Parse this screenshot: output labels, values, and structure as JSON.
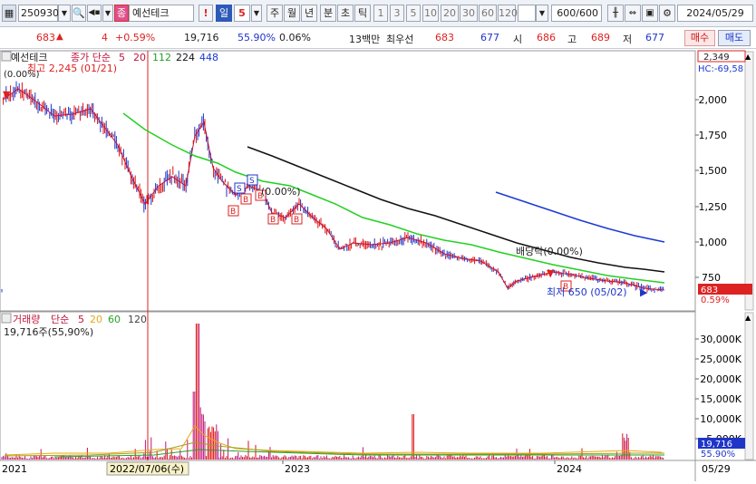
{
  "toolbar": {
    "code": "250930",
    "jong": "종",
    "name": "예선테크",
    "alert": "!",
    "period_label": "일",
    "period_value": "5",
    "ju": "주",
    "wol": "월",
    "nyeon": "년",
    "bun": "분",
    "cho": "초",
    "tik": "틱",
    "intervals": [
      "1",
      "3",
      "5",
      "10",
      "20",
      "30",
      "60",
      "120"
    ],
    "count": "600/600",
    "date": "2024/05/29"
  },
  "info": {
    "price": "683",
    "change": "4",
    "change_pct": "+0.59%",
    "volume": "19,716",
    "vol_ratio": "55.90%",
    "turnover": "0.06%",
    "unit": "13백만",
    "priority": "최우선",
    "ask": "683",
    "bid": "677",
    "open_label": "시",
    "open": "686",
    "high_label": "고",
    "high": "689",
    "low_label": "저",
    "low": "677",
    "buy": "매수",
    "sell": "매도"
  },
  "price_panel": {
    "title": "예선테크",
    "ma_label": "종가 단순",
    "ma_periods": [
      "5",
      "20",
      "112",
      "224",
      "448"
    ],
    "high_note": "최고 2,245 (01/21)",
    "low_note": "최저 650 (05/02)",
    "pct_note1": "(0.00%)",
    "pct_note2": "배당락(0.00%)",
    "pct_note3": "(0.00%)",
    "hc_label": "HC:-69,58",
    "top_value": "2,349",
    "current": "683",
    "current_pct": "0.59%"
  },
  "volume_panel": {
    "title": "거래량",
    "ma_label": "단순",
    "ma_periods": [
      "5",
      "20",
      "60",
      "120"
    ],
    "note": "19,716주(55,90%)",
    "current": "19,716",
    "current_pct": "55.90%"
  },
  "axis": {
    "price_ticks": [
      "2,000",
      "1,750",
      "1,500",
      "1,250",
      "1,000",
      "750"
    ],
    "volume_ticks": [
      "30,000K",
      "25,000K",
      "20,000K",
      "15,000K",
      "10,000K",
      "5,000K"
    ],
    "x_labels": [
      "2021",
      "2023",
      "2024",
      "05/29"
    ],
    "cursor_date": "2022/07/06(수)"
  },
  "colors": {
    "up": "#dd1111",
    "down": "#1f35c8",
    "ma5": "#c0143c",
    "ma20": "#22d022",
    "ma112": "#111111",
    "ma224": "#1a3ad4",
    "ma448": "#2233aa",
    "vol_ma5": "#e6a817",
    "vol_ma20": "#a0a020",
    "vol_ma60": "#27a327",
    "vol_ma120": "#444444"
  },
  "chart_data": {
    "type": "line",
    "title": "예선테크",
    "x": [
      "2021",
      "2022",
      "2023",
      "2024",
      "2024-05-29"
    ],
    "series": [
      {
        "name": "종가",
        "values": [
          2050,
          1200,
          1150,
          720,
          683
        ]
      },
      {
        "name": "112",
        "values": [
          null,
          null,
          1670,
          850,
          790
        ]
      },
      {
        "name": "224",
        "values": [
          null,
          null,
          null,
          1350,
          1010
        ]
      },
      {
        "name": "거래량",
        "values": [
          1500,
          35000,
          3000,
          8000,
          19.716
        ]
      }
    ],
    "ylim": [
      600,
      2350
    ]
  }
}
